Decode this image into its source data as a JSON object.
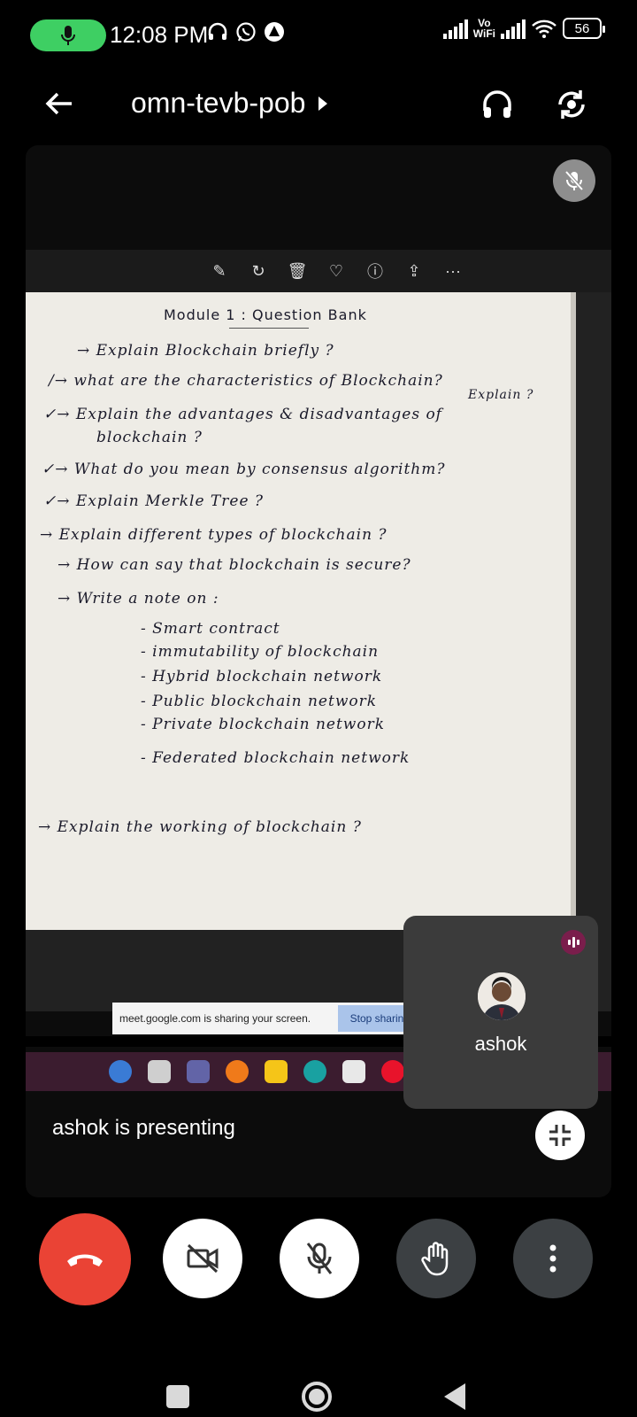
{
  "status_bar": {
    "time": "12:08 PM",
    "network_label_top": "Vo",
    "network_label_bottom": "WiFi",
    "battery": "56"
  },
  "header": {
    "meeting_code": "omn-tevb-pob",
    "back_icon": "back-arrow-icon",
    "audio_icon": "headphones-icon",
    "switch_icon": "switch-camera-icon"
  },
  "document": {
    "title": "Module 1 : Question Bank",
    "lines": [
      "→ Explain Blockchain briefly ?",
      "/→ what are the characteristics of Blockchain?",
      "Explain ?",
      "✓→ Explain the advantages & disadvantages of",
      "blockchain ?",
      "✓→ What do you mean by consensus algorithm?",
      "✓→ Explain Merkle Tree ?",
      "→ Explain different types of blockchain ?",
      "→ How can say that blockchain is secure?",
      "→ Write a note on :",
      "- Smart contract",
      "- immutability of blockchain",
      "- Hybrid blockchain network",
      "- Public blockchain network",
      "- Private blockchain network",
      "- Federated blockchain network",
      "→ Explain the working of blockchain ?"
    ]
  },
  "share_banner": {
    "text": "meet.google.com is sharing your screen.",
    "stop_label": "Stop sharing"
  },
  "presenting_text": "ashok is presenting",
  "self_view": {
    "name": "ashok"
  },
  "colors": {
    "end_call": "#ea4335",
    "mic_pill": "#3ecf63",
    "tile_bg": "#3b3b3b"
  }
}
